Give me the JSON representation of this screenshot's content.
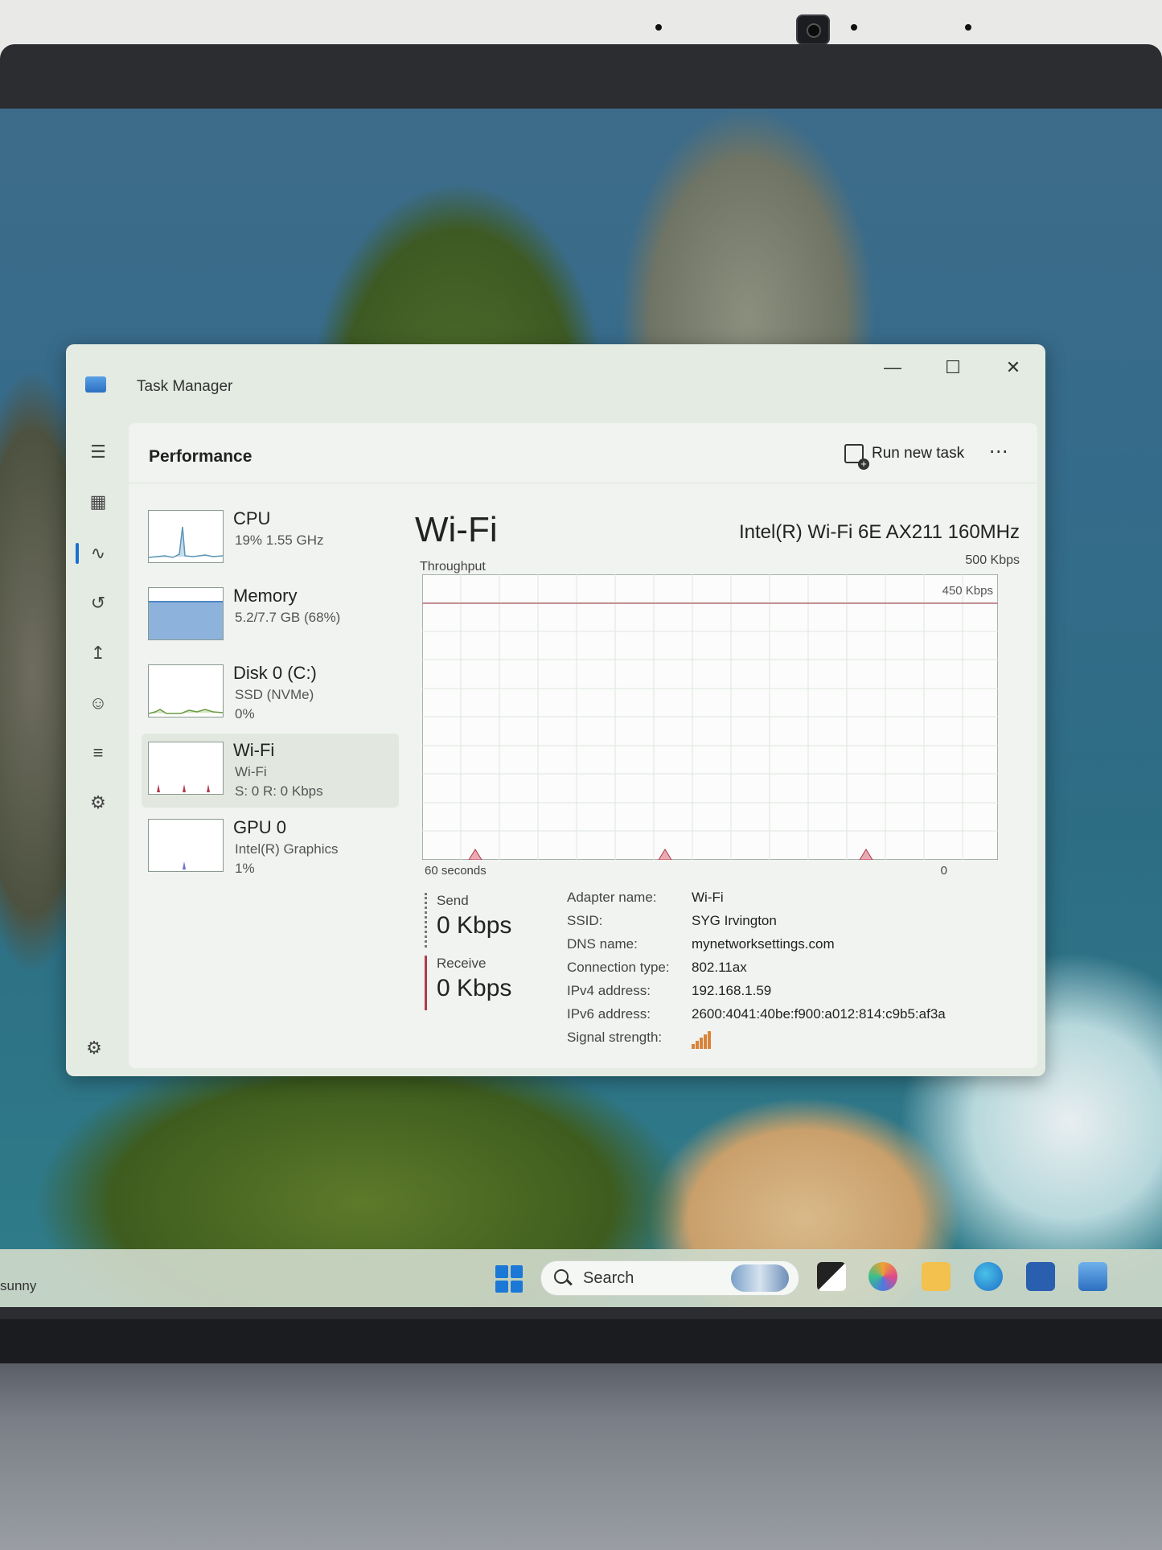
{
  "window": {
    "title": "Task Manager"
  },
  "header": {
    "page_title": "Performance",
    "run_new_task": "Run new task"
  },
  "resources": [
    {
      "name": "CPU",
      "sub1": "19%  1.55 GHz",
      "sub2": ""
    },
    {
      "name": "Memory",
      "sub1": "5.2/7.7 GB (68%)",
      "sub2": ""
    },
    {
      "name": "Disk 0 (C:)",
      "sub1": "SSD (NVMe)",
      "sub2": "0%"
    },
    {
      "name": "Wi-Fi",
      "sub1": "Wi-Fi",
      "sub2": "S: 0 R: 0 Kbps"
    },
    {
      "name": "GPU 0",
      "sub1": "Intel(R) Graphics",
      "sub2": "1%"
    }
  ],
  "detail": {
    "title": "Wi-Fi",
    "adapter_model": "Intel(R) Wi-Fi 6E AX211 160MHz",
    "graph_label": "Throughput",
    "graph_max": "500 Kbps",
    "graph_line_label": "450 Kbps",
    "x_left": "60 seconds",
    "x_right": "0",
    "send_label": "Send",
    "send_value": "0 Kbps",
    "receive_label": "Receive",
    "receive_value": "0 Kbps",
    "properties": [
      {
        "label": "Adapter name:",
        "value": "Wi-Fi"
      },
      {
        "label": "SSID:",
        "value": "SYG Irvington"
      },
      {
        "label": "DNS name:",
        "value": "mynetworksettings.com"
      },
      {
        "label": "Connection type:",
        "value": "802.11ax"
      },
      {
        "label": "IPv4 address:",
        "value": "192.168.1.59"
      },
      {
        "label": "IPv6 address:",
        "value": "2600:4041:40be:f900:a012:814:c9b5:af3a"
      },
      {
        "label": "Signal strength:",
        "value": ""
      }
    ]
  },
  "taskbar": {
    "weather": "sunny",
    "search_label": "Search"
  },
  "colors": {
    "accent": "#1a6fd1",
    "receive": "#b03a4a",
    "graph_line": "#b8707a",
    "memory_fill": "#8db3dd"
  },
  "icons": [
    "menu-icon",
    "dashboard-icon",
    "performance-icon",
    "history-icon",
    "startup-icon",
    "users-icon",
    "details-icon",
    "services-icon",
    "settings-icon",
    "run-task-icon",
    "more-icon"
  ]
}
